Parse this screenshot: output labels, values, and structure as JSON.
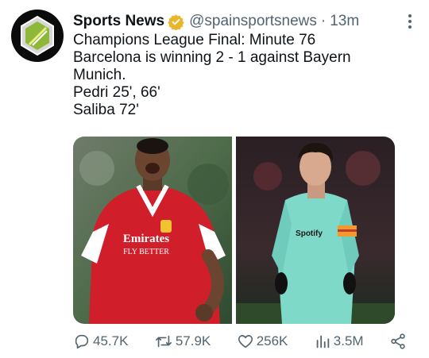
{
  "tweet": {
    "author_name": "Sports News",
    "handle": "@spainsportsnews",
    "separator": "·",
    "time": "13m",
    "text_lines": [
      "Champions League Final: Minute 76",
      "Barcelona is winning 2 - 1 against Bayern",
      "Munich.",
      "Pedri 25', 66'",
      "Saliba 72'"
    ]
  },
  "media": {
    "left_photo_shirt_text": [
      "Emirates",
      "FLY BETTER"
    ],
    "right_photo_shirt_text": "Spotify"
  },
  "actions": {
    "reply_count": "45.7K",
    "retweet_count": "57.9K",
    "like_count": "256K",
    "view_count": "3.5M"
  },
  "colors": {
    "verified": "#e8b72c",
    "secondary_text": "#536471"
  }
}
